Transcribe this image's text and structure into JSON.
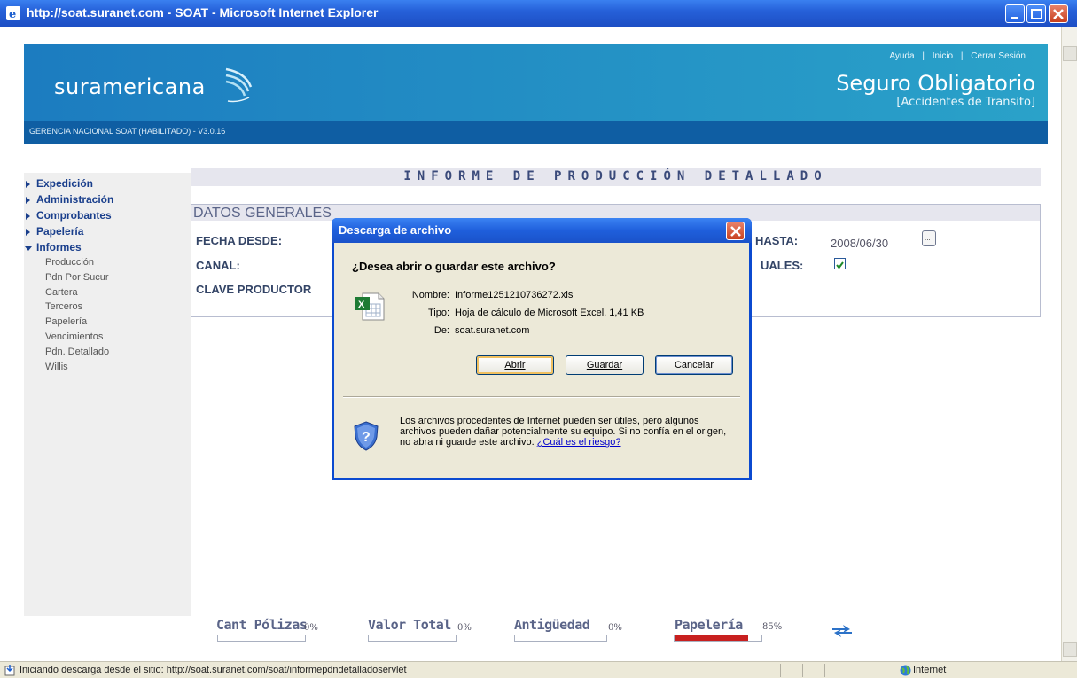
{
  "window": {
    "title": "http://soat.suranet.com - SOAT - Microsoft Internet Explorer"
  },
  "header": {
    "logo": "suramericana",
    "links": [
      "Ayuda",
      "Inicio",
      "Cerrar Sesión"
    ],
    "link_separator": "|",
    "product_title": "Seguro Obligatorio",
    "product_subtitle": "[Accidentes de Transito]",
    "version_bar": "GERENCIA NACIONAL SOAT (HABILITADO) - V3.0.16"
  },
  "sidebar": {
    "items": [
      {
        "label": "Expedición",
        "open": false
      },
      {
        "label": "Administración",
        "open": false
      },
      {
        "label": "Comprobantes",
        "open": false
      },
      {
        "label": "Papelería",
        "open": false
      },
      {
        "label": "Informes",
        "open": true
      }
    ],
    "subitems": [
      "Producción",
      "Pdn Por Sucur",
      "Cartera",
      "Terceros",
      "Papelería",
      "Vencimientos",
      "Pdn. Detallado",
      "Willis"
    ]
  },
  "main": {
    "report_title": "INFORME DE PRODUCCIÓN DETALLADO",
    "section_title": "DATOS GENERALES",
    "fields": {
      "fecha_desde_label": "FECHA DESDE:",
      "canal_label": "CANAL:",
      "clave_productor_label": "CLAVE PRODUCTOR",
      "hasta_label": "HASTA:",
      "hasta_value": "2008/06/30",
      "anuales_label": "UALES:",
      "calendar_button": "..."
    }
  },
  "indicators": [
    {
      "label": "Cant Pólizas",
      "percent_text": "0%",
      "fill": 0
    },
    {
      "label": "Valor Total",
      "percent_text": "0%",
      "fill": 0
    },
    {
      "label": "Antigüedad",
      "percent_text": "0%",
      "fill": 0
    },
    {
      "label": "Papelería",
      "percent_text": "85%",
      "fill": 0.85
    }
  ],
  "dialog": {
    "title": "Descarga de archivo",
    "question": "¿Desea abrir o guardar este archivo?",
    "name_key": "Nombre:",
    "name_value": "Informe1251210736272.xls",
    "type_key": "Tipo:",
    "type_value": "Hoja de cálculo de Microsoft Excel, 1,41 KB",
    "from_key": "De:",
    "from_value": "soat.suranet.com",
    "buttons": {
      "open": "Abrir",
      "save": "Guardar",
      "cancel": "Cancelar"
    },
    "warning": "Los archivos procedentes de Internet pueden ser útiles, pero algunos archivos pueden dañar potencialmente su equipo. Si no confía en el origen, no abra ni guarde este archivo.",
    "warning_link": "¿Cuál es el riesgo?"
  },
  "statusbar": {
    "text": "Iniciando descarga desde el sitio: http://soat.suranet.com/soat/informepdndetalladoservlet",
    "zone": "Internet"
  },
  "colors": {
    "header_start": "#1c7cc0",
    "header_end": "#2aa2c9",
    "version_bar": "#0f5ea3",
    "xp_blue": "#1f5fdc",
    "progress_fill": "#c8201f"
  }
}
